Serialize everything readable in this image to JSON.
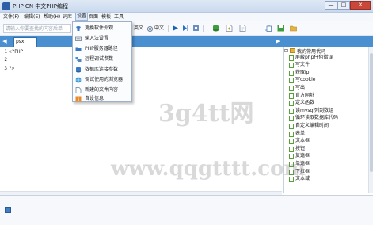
{
  "window": {
    "title": "PHP CN 中文PHP编程",
    "min_glyph": "—",
    "max_glyph": "□",
    "close_glyph": "✕"
  },
  "menubar": {
    "items": [
      "文件(F)",
      "编辑(E)",
      "帮助(H)",
      "词库",
      "设置",
      "页面",
      "模板",
      "工具"
    ],
    "active": "设置"
  },
  "toolbar": {
    "search_placeholder": "请输入你要查找的内容后单",
    "radio_english": "英文",
    "radio_chinese": "中文",
    "selected": "中文"
  },
  "tabs": {
    "prev_glyph": "◀",
    "next_glyph": "▶",
    "active_tab": "psx"
  },
  "editor": {
    "lines": [
      {
        "num": "1",
        "code": "<?PHP"
      },
      {
        "num": "2",
        "code": ""
      },
      {
        "num": "3",
        "code": "?>"
      }
    ]
  },
  "settings_menu": {
    "items": [
      {
        "label": "更换软件外观",
        "icon": "skin-icon"
      },
      {
        "label": "输入法设置",
        "icon": "keyboard-icon"
      },
      {
        "label": "PHP服务器路径",
        "icon": "folder-icon"
      },
      {
        "label": "远程调试参数",
        "icon": "network-icon"
      },
      {
        "label": "数据库连接参数",
        "icon": "database-icon"
      },
      {
        "label": "调试使用的浏览器",
        "icon": "browser-icon"
      },
      {
        "label": "新建的文件内容",
        "icon": "new-file-icon"
      },
      {
        "label": "自设信息",
        "icon": "info-icon"
      }
    ]
  },
  "side_panel": {
    "root": "我的常用代码",
    "items": [
      "屏蔽php任何错误",
      "写文件",
      "获取ip",
      "写cookie",
      "写出",
      "官方网址",
      "定义函数",
      "读mysql列到数组",
      "循环读取数据库代码",
      "自定义编辑时间",
      "表单",
      "文本框",
      "按钮",
      "复选框",
      "单选框",
      "下拉框",
      "文本域"
    ]
  },
  "watermarks": {
    "mark_1": "3g4tt网",
    "mark_2": "www.qqgtttt.com"
  },
  "colors": {
    "tab_bar": "#4a8fd0",
    "accent": "#1b5fb5",
    "close_button": "#c9483a"
  }
}
